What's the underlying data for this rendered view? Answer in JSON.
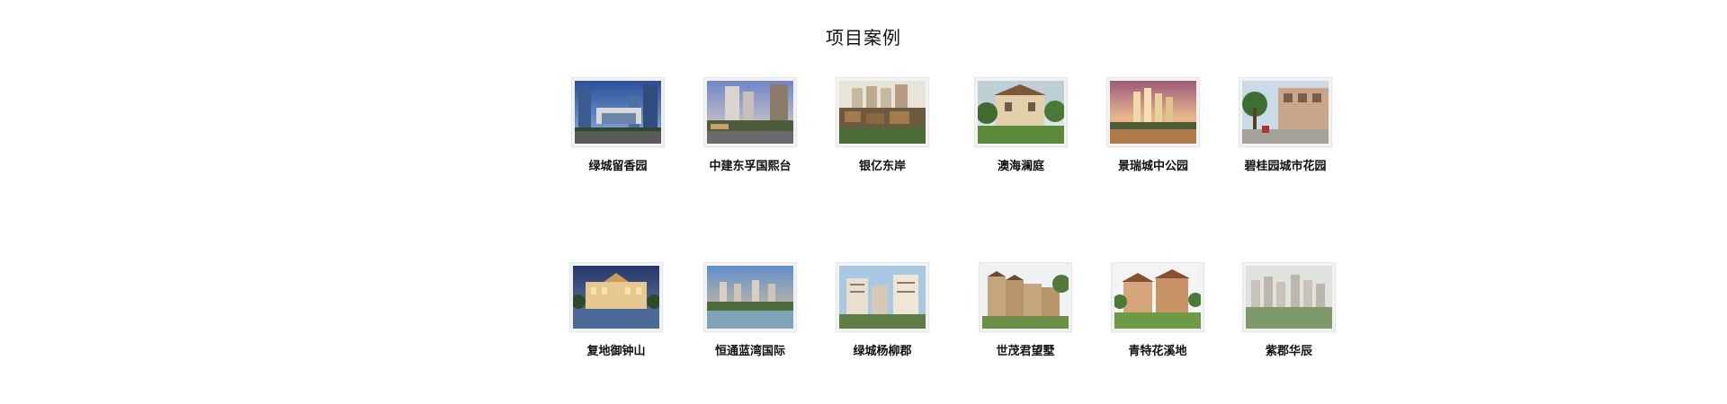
{
  "section": {
    "title": "项目案例"
  },
  "projects": [
    {
      "name": "绿城留香园",
      "image": "modern-tower-gate"
    },
    {
      "name": "中建东孚国熙台",
      "image": "highrise-street"
    },
    {
      "name": "银亿东岸",
      "image": "villa-cluster"
    },
    {
      "name": "澳海澜庭",
      "image": "european-villa"
    },
    {
      "name": "景瑞城中公园",
      "image": "sunset-towers"
    },
    {
      "name": "碧桂园城市花园",
      "image": "shopping-street"
    },
    {
      "name": "复地御钟山",
      "image": "night-palace"
    },
    {
      "name": "恒通蓝湾国际",
      "image": "lakeside-towers"
    },
    {
      "name": "绿城杨柳郡",
      "image": "apartment-blocks"
    },
    {
      "name": "世茂君望墅",
      "image": "townhouse-row"
    },
    {
      "name": "青特花溪地",
      "image": "garden-villas"
    },
    {
      "name": "紫郡华辰",
      "image": "aerial-estate"
    }
  ]
}
